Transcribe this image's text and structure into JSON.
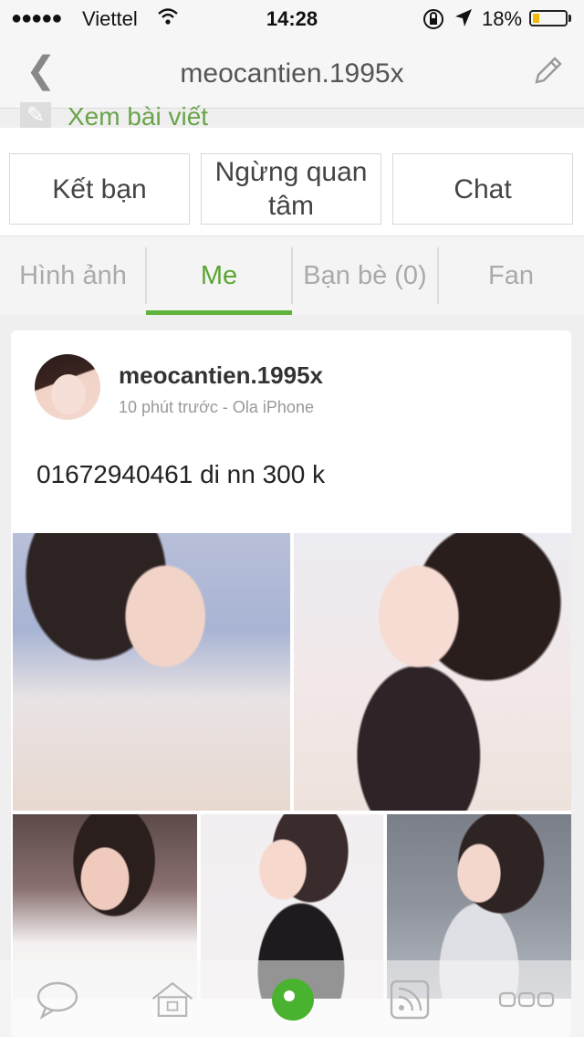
{
  "status": {
    "signal": "●●●●●",
    "carrier": "Viettel",
    "time": "14:28",
    "battery": "18%",
    "battery_level": 0.18
  },
  "nav": {
    "back": "❮",
    "title": "meocantien.1995x"
  },
  "xem": {
    "label": "Xem bài viết"
  },
  "actions": {
    "add_friend": "Kết bạn",
    "unfollow": "Ngừng quan tâm",
    "chat": "Chat"
  },
  "tabs": [
    {
      "label": "Hình ảnh"
    },
    {
      "label": "Me"
    },
    {
      "label": "Bạn bè (0)"
    },
    {
      "label": "Fan"
    }
  ],
  "post": {
    "username": "meocantien.1995x",
    "meta": "10 phút trước - Ola iPhone",
    "text": "01672940461 di nn 300 k"
  },
  "icons": {
    "tabbar": [
      "chat-bubble-icon",
      "home-icon",
      "profile-icon",
      "feed-icon",
      "more-icon"
    ],
    "active_color": "#5aa631"
  }
}
